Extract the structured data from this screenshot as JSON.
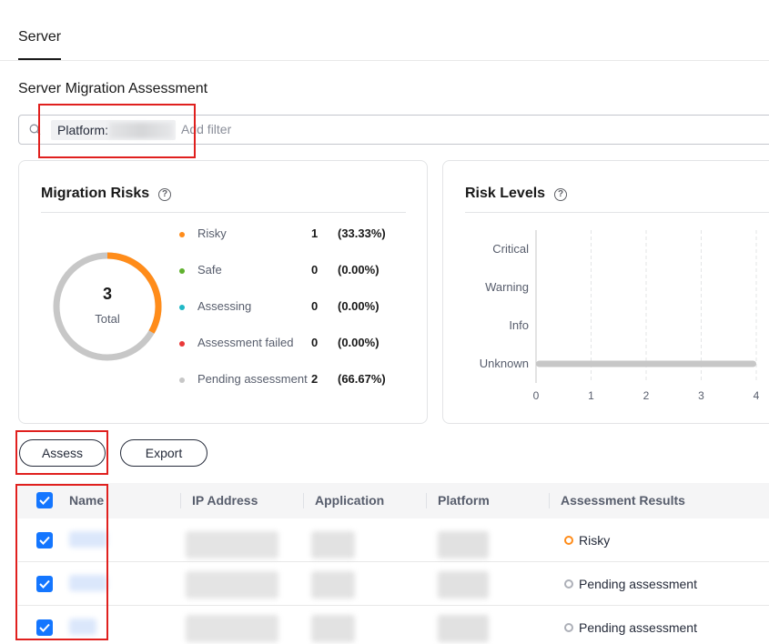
{
  "tabs": {
    "active": "Server"
  },
  "page": {
    "title": "Server Migration Assessment"
  },
  "search": {
    "chip_label": "Platform:",
    "placeholder": "Add filter"
  },
  "risks_card": {
    "title": "Migration Risks",
    "total": "3",
    "total_label": "Total",
    "legend": [
      {
        "name": "Risky",
        "count": "1",
        "pct": "(33.33%)",
        "color": "#ff8c1a"
      },
      {
        "name": "Safe",
        "count": "0",
        "pct": "(0.00%)",
        "color": "#5fb12e"
      },
      {
        "name": "Assessing",
        "count": "0",
        "pct": "(0.00%)",
        "color": "#20b8c6"
      },
      {
        "name": "Assessment failed",
        "count": "0",
        "pct": "(0.00%)",
        "color": "#e93838"
      },
      {
        "name": "Pending assessment",
        "count": "2",
        "pct": "(66.67%)",
        "color": "#c7c7c7"
      }
    ]
  },
  "levels_card": {
    "title": "Risk Levels"
  },
  "chart_data": {
    "type": "bar",
    "orientation": "horizontal",
    "categories": [
      "Critical",
      "Warning",
      "Info",
      "Unknown"
    ],
    "values": [
      0,
      0,
      0,
      4
    ],
    "xlim": [
      0,
      4
    ],
    "x_ticks": [
      "0",
      "1",
      "2",
      "3",
      "4"
    ],
    "grid": true,
    "color": "#c7c7c7"
  },
  "toolbar": {
    "assess_label": "Assess",
    "export_label": "Export"
  },
  "table": {
    "columns": [
      "Name",
      "IP Address",
      "Application",
      "Platform",
      "Assessment Results"
    ],
    "rows": [
      {
        "result": "Risky",
        "result_color": "#ff8c1a"
      },
      {
        "result": "Pending assessment",
        "result_color": "#adb0b8"
      },
      {
        "result": "Pending assessment",
        "result_color": "#adb0b8"
      }
    ]
  },
  "colors": {
    "accent": "#1476ff",
    "highlight_box": "#e0201e"
  }
}
